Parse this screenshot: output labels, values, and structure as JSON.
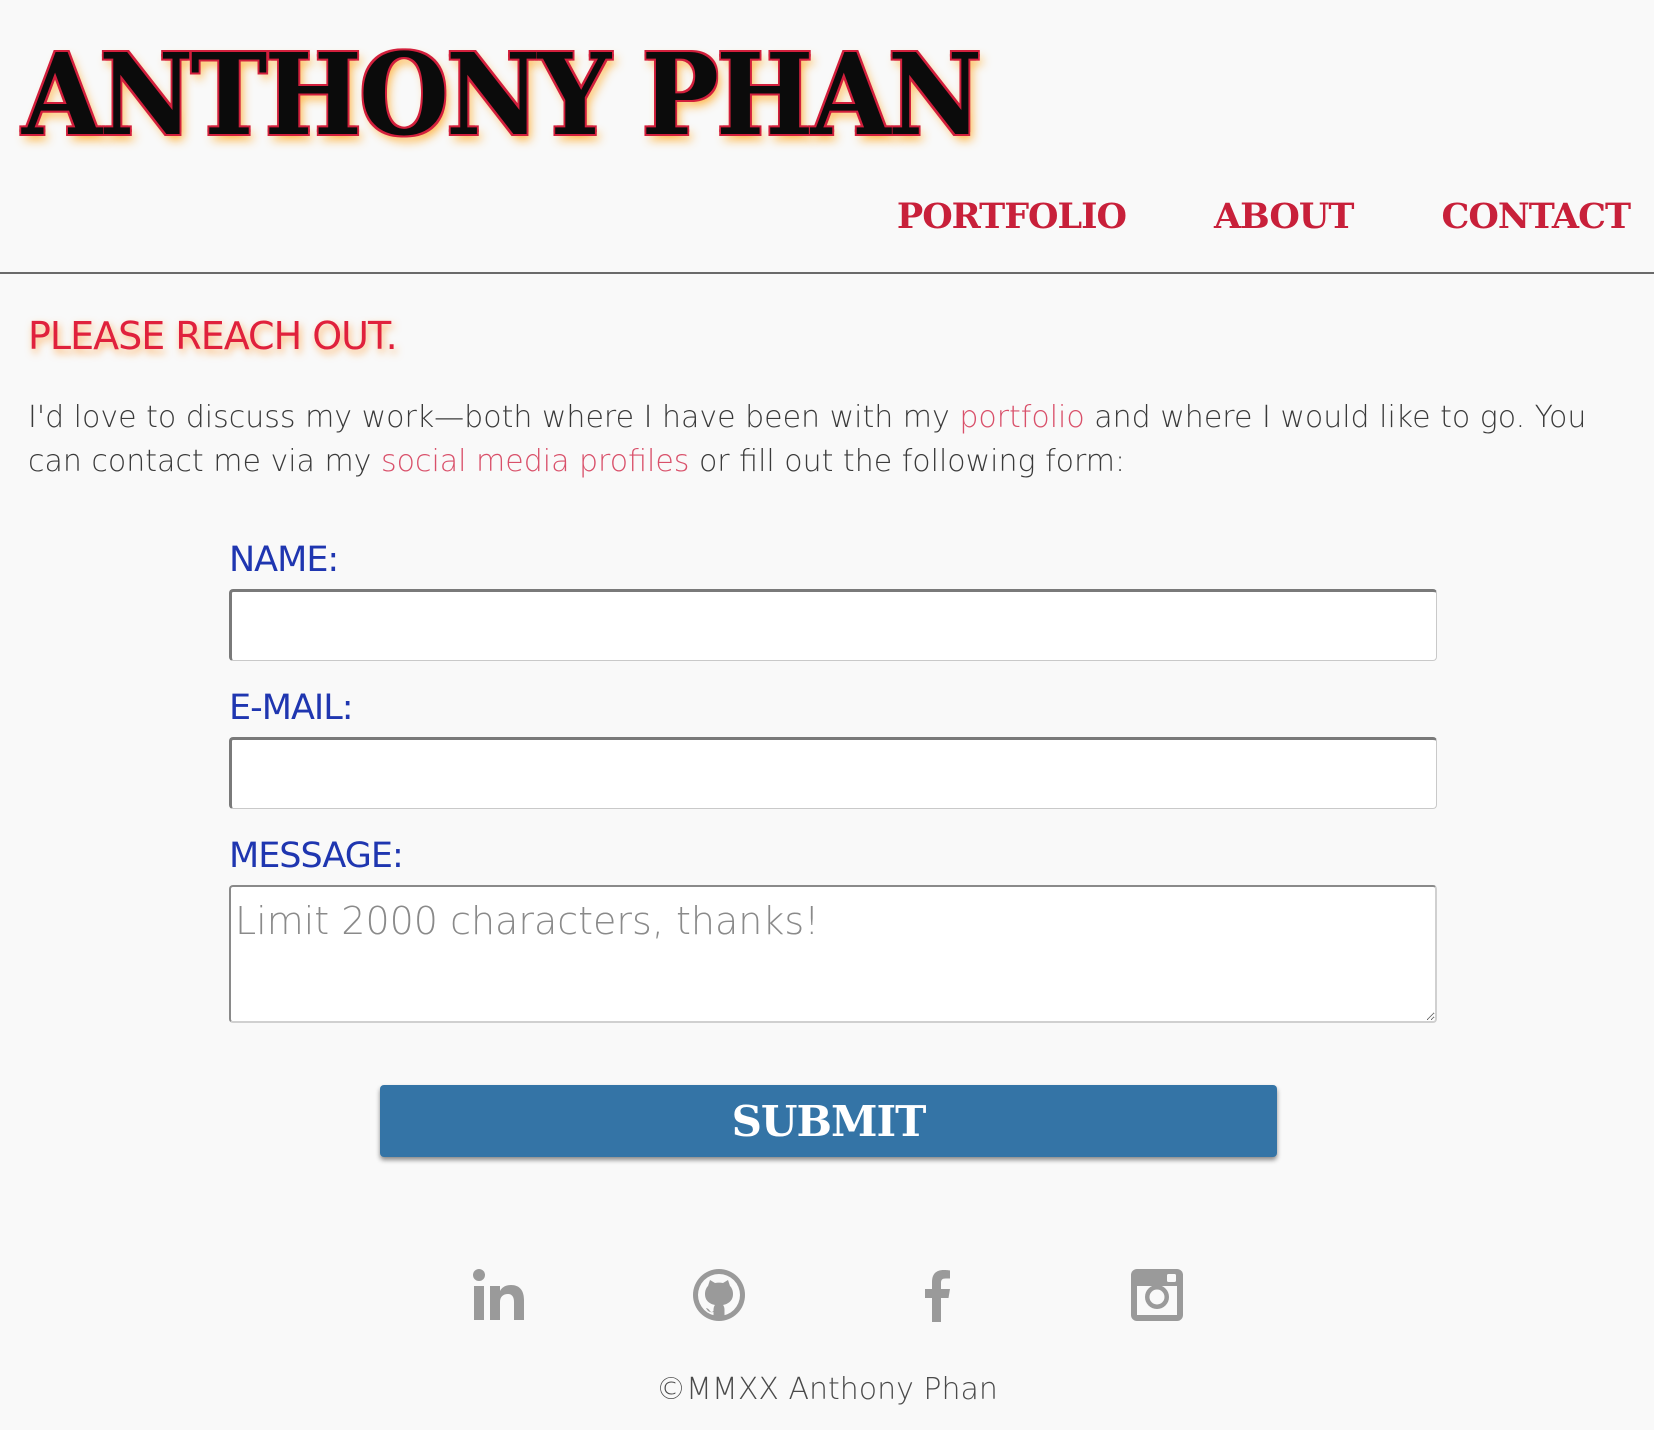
{
  "header": {
    "logo_text": "ANTHONY PHAN",
    "nav": [
      {
        "label": "PORTFOLIO"
      },
      {
        "label": "ABOUT"
      },
      {
        "label": "CONTACT"
      }
    ]
  },
  "main": {
    "headline": "PLEASE REACH OUT.",
    "intro": {
      "part1": "I'd love to discuss my work—both where I have been with my ",
      "link1": "portfolio",
      "part2": " and where I would like to go. You can contact me via my ",
      "link2": "social media profiles",
      "part3": " or fill out the following form:"
    },
    "form": {
      "name_label": "NAME:",
      "name_value": "",
      "email_label": "E-MAIL:",
      "email_value": "",
      "message_label": "MESSAGE:",
      "message_placeholder": "Limit 2000 characters, thanks!",
      "submit_label": "SUBMIT"
    }
  },
  "footer": {
    "social": [
      {
        "icon": "linkedin-icon"
      },
      {
        "icon": "github-icon"
      },
      {
        "icon": "facebook-icon"
      },
      {
        "icon": "instagram-icon"
      }
    ],
    "copyright": "©MMXX Anthony Phan"
  },
  "colors": {
    "background": "#f9f9f9",
    "accent_red": "#c8203a",
    "label_blue": "#1f36b0",
    "button_blue": "#3474a6",
    "icon_gray": "#9a9a9a"
  }
}
